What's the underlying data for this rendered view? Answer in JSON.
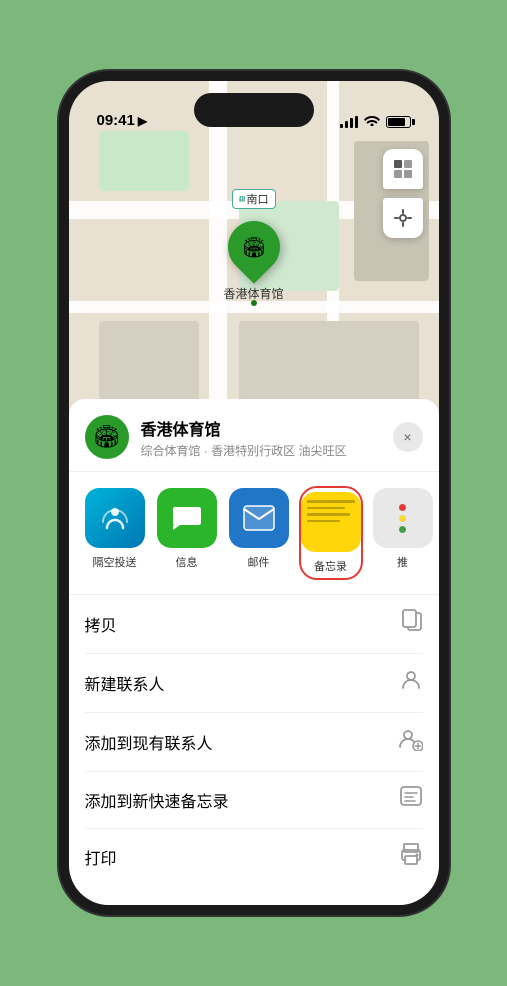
{
  "status_bar": {
    "time": "09:41",
    "location_arrow": "➤"
  },
  "map": {
    "label_text": "南口",
    "pin_label": "香港体育馆",
    "controls": {
      "map_icon": "🗺",
      "location_icon": "◎"
    }
  },
  "sheet": {
    "venue_name": "香港体育馆",
    "venue_subtitle": "综合体育馆 · 香港特别行政区 油尖旺区",
    "close_label": "×",
    "share_items": [
      {
        "id": "airdrop",
        "label": "隔空投送"
      },
      {
        "id": "messages",
        "label": "信息"
      },
      {
        "id": "mail",
        "label": "邮件"
      },
      {
        "id": "notes",
        "label": "备忘录"
      },
      {
        "id": "more",
        "label": "推"
      }
    ],
    "actions": [
      {
        "label": "拷贝",
        "icon": "copy"
      },
      {
        "label": "新建联系人",
        "icon": "person"
      },
      {
        "label": "添加到现有联系人",
        "icon": "person-add"
      },
      {
        "label": "添加到新快速备忘录",
        "icon": "quick-note"
      },
      {
        "label": "打印",
        "icon": "print"
      }
    ]
  }
}
